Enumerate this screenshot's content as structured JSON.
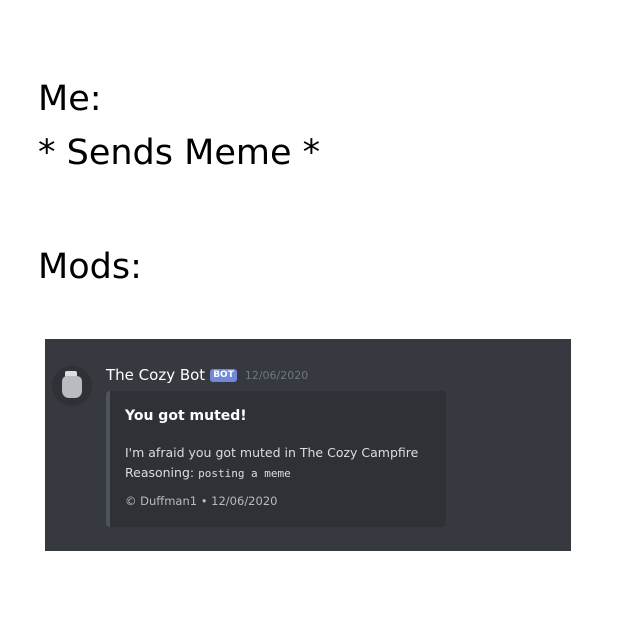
{
  "caption": {
    "line1": "Me:",
    "line2": "* Sends Meme *",
    "line3": "Mods:"
  },
  "message": {
    "username": "The Cozy Bot",
    "bot_tag": "BOT",
    "timestamp": "12/06/2020",
    "embed": {
      "title": "You got muted!",
      "description_line1": "I'm afraid you got muted in The Cozy Campfire",
      "reason_label": "Reasoning: ",
      "reason_value": "posting a meme",
      "footer": "© Duffman1 • 12/06/2020"
    }
  },
  "colors": {
    "chat_background": "#36393f",
    "embed_background": "#2f3136",
    "bot_tag": "#7289da"
  },
  "icons": {
    "avatar": "campfire-avatar-icon"
  }
}
